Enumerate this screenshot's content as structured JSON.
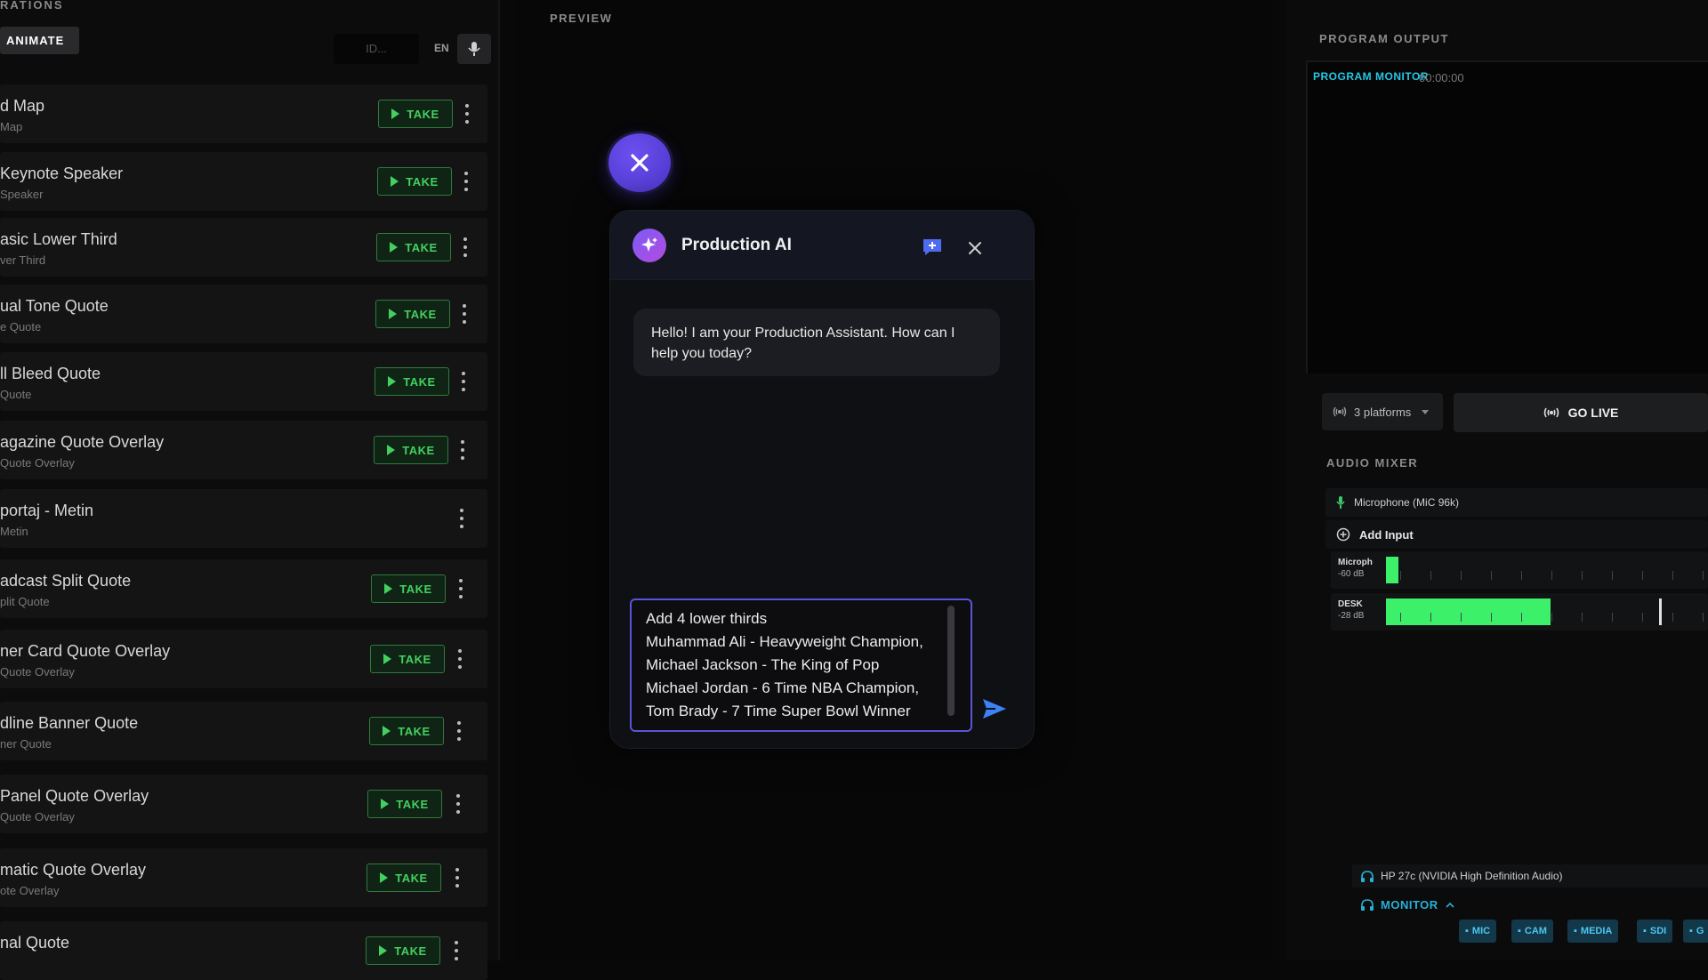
{
  "left_panel": {
    "title": "RATIONS",
    "animate_label": "ANIMATE",
    "id_placeholder": "ID...",
    "lang": "EN",
    "templates": [
      {
        "name": "d Map",
        "sub": "Map",
        "take_label": "TAKE",
        "has_take": true
      },
      {
        "name": "Keynote Speaker",
        "sub": "Speaker",
        "take_label": "TAKE",
        "has_take": true
      },
      {
        "name": "asic Lower Third",
        "sub": "ver Third",
        "take_label": "TAKE",
        "has_take": true
      },
      {
        "name": "ual Tone Quote",
        "sub": "e Quote",
        "take_label": "TAKE",
        "has_take": true
      },
      {
        "name": "ll Bleed Quote",
        "sub": "Quote",
        "take_label": "TAKE",
        "has_take": true
      },
      {
        "name": "agazine Quote Overlay",
        "sub": "Quote Overlay",
        "take_label": "TAKE",
        "has_take": true
      },
      {
        "name": "portaj - Metin",
        "sub": "Metin",
        "take_label": "",
        "has_take": false
      },
      {
        "name": "adcast Split Quote",
        "sub": "plit Quote",
        "take_label": "TAKE",
        "has_take": true
      },
      {
        "name": "ner Card Quote Overlay",
        "sub": "Quote Overlay",
        "take_label": "TAKE",
        "has_take": true
      },
      {
        "name": "dline Banner Quote",
        "sub": "ner Quote",
        "take_label": "TAKE",
        "has_take": true
      },
      {
        "name": "Panel Quote Overlay",
        "sub": "Quote Overlay",
        "take_label": "TAKE",
        "has_take": true
      },
      {
        "name": "matic Quote Overlay",
        "sub": "ote Overlay",
        "take_label": "TAKE",
        "has_take": true
      },
      {
        "name": "nal Quote",
        "sub": "",
        "take_label": "TAKE",
        "has_take": true
      }
    ]
  },
  "preview": {
    "label": "PREVIEW"
  },
  "chat": {
    "title": "Production AI",
    "greeting": "Hello! I am your Production Assistant. How can I help you today?",
    "input_lines": [
      "Add 4 lower thirds",
      "Muhammad Ali - Heavyweight Champion,",
      "Michael Jackson - The King of Pop",
      "Michael Jordan - 6 Time NBA Champion,",
      "Tom Brady - 7 Time Super Bowl Winner"
    ]
  },
  "program_output": {
    "label": "PROGRAM OUTPUT",
    "monitor_label": "PROGRAM MONITOR",
    "timecode": "00:00:00",
    "platforms_label": "3 platforms",
    "go_live_label": "GO LIVE"
  },
  "audio_mixer": {
    "label": "AUDIO MIXER",
    "mic_input": "Microphone (MiC 96k)",
    "add_input": "Add Input",
    "channels": [
      {
        "name": "Microph",
        "db": "-60 dB",
        "level": 0.04
      },
      {
        "name": "DESK",
        "db": "-28 dB",
        "level": 0.51
      }
    ],
    "output_device": "HP 27c (NVIDIA High Definition Audio)",
    "monitor_label": "MONITOR",
    "chips": [
      "MIC",
      "CAM",
      "MEDIA",
      "SDI",
      "G"
    ]
  },
  "colors": {
    "accent": "#5a55d8",
    "take_green": "#44d060",
    "meter_green": "#3df06a",
    "cyan": "#25c8e8"
  }
}
